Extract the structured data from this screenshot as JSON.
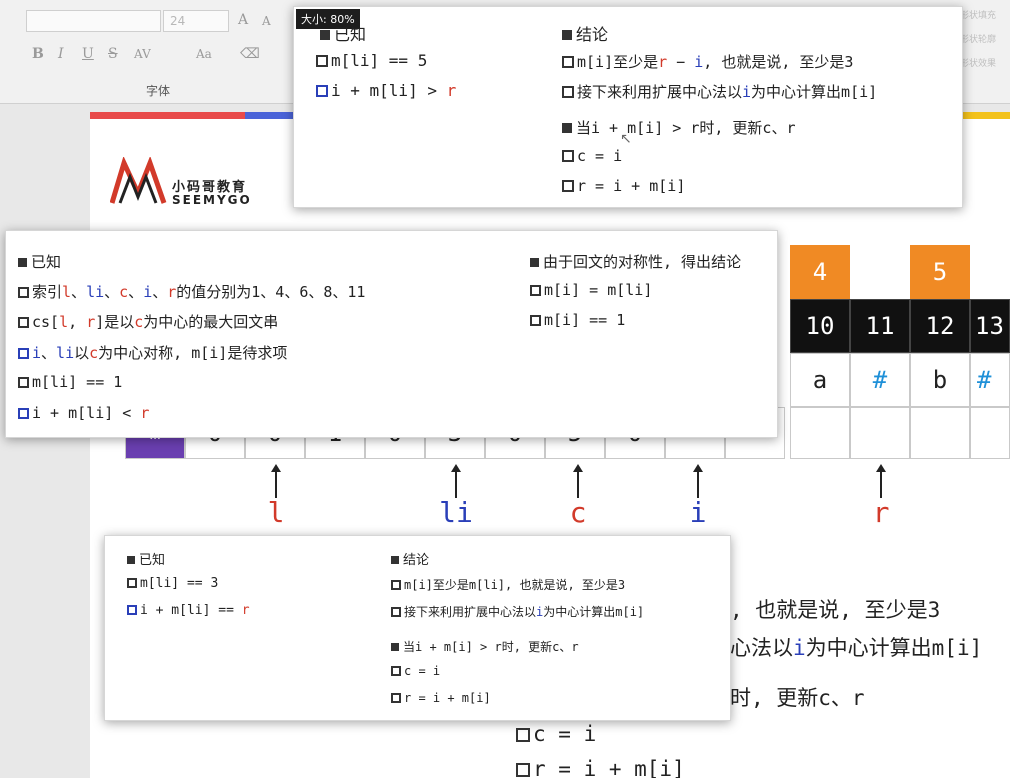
{
  "ribbon": {
    "font_name": "",
    "font_size": "24",
    "group_label": "字体",
    "btn_grow": "A",
    "btn_shrink": "A",
    "bold": "B",
    "italic": "I",
    "underline": "U",
    "strike": "S",
    "spacing": "AV",
    "case": "Aa",
    "right_labels": [
      "形状填充",
      "形状轮廓",
      "形状效果"
    ]
  },
  "logo": {
    "cn": "小码哥教育",
    "en": "SEEMYGO"
  },
  "tooltip": "大小: 80%",
  "table": {
    "top_numbers": [
      {
        "index": 0,
        "text": "4"
      },
      {
        "index": 2,
        "text": "5"
      }
    ],
    "indices": [
      "10",
      "11",
      "12",
      "13"
    ],
    "chars": [
      "a",
      "#",
      "b",
      "#"
    ],
    "row_m_first": "m",
    "row_m_values": [
      "0",
      "0",
      "1",
      "0",
      "3",
      "0",
      "5",
      "0"
    ]
  },
  "pointers": [
    {
      "label": "l",
      "color": "#d23a2a"
    },
    {
      "label": "li",
      "color": "#2a3fb8"
    },
    {
      "label": "c",
      "color": "#d23a2a"
    },
    {
      "label": "i",
      "color": "#2a3fb8"
    },
    {
      "label": "r",
      "color": "#d23a2a"
    }
  ],
  "background_lines": [
    ", 也就是说, 至少是3",
    "心法以",
    "i",
    "为中心计算出m[i]",
    "时, 更新c、r",
    "c = i",
    "r = i + m[i]"
  ],
  "card_top": {
    "known_title": "已知",
    "known_1": "m[li] == 5",
    "known_2_pre": "i + m[li] > ",
    "known_2_r": "r",
    "concl_title": "结论",
    "concl_1_a": "m[i]至少是",
    "concl_1_r": "r",
    "concl_1_b": " − ",
    "concl_1_i": "i",
    "concl_1_c": ", 也就是说, 至少是3",
    "concl_2": "接下来利用扩展中心法以",
    "concl_2_i": "i",
    "concl_2_b": "为中心计算出m[i]",
    "concl_3": "当i + m[i] > r时, 更新c、r",
    "concl_4": "c = i",
    "concl_5": "r = i + m[i]"
  },
  "card_mid": {
    "known_title": "已知",
    "k1_a": "索引",
    "k1_l": "l",
    "k1_s1": "、",
    "k1_li": "li",
    "k1_s2": "、",
    "k1_c": "c",
    "k1_s3": "、",
    "k1_i": "i",
    "k1_s4": "、",
    "k1_r": "r",
    "k1_b": "的值分别为1、4、6、8、11",
    "k2_a": "cs[",
    "k2_l": "l",
    "k2_b": ", ",
    "k2_r": "r",
    "k2_c": "]是以",
    "k2_cc": "c",
    "k2_d": "为中心的最大回文串",
    "k3_i": "i",
    "k3_a": "、",
    "k3_li": "li",
    "k3_b": "以",
    "k3_c": "c",
    "k3_d": "为中心对称, m[i]是待求项",
    "k4": "m[li] == 1",
    "k5_a": "i + m[li] < ",
    "k5_r": "r",
    "concl_title": "由于回文的对称性, 得出结论",
    "c1": "m[i] = m[li]",
    "c2": "m[i] == 1"
  },
  "card_bottom": {
    "known_title": "已知",
    "known_1": "m[li] == 3",
    "known_2_pre": "i + m[li] == ",
    "known_2_r": "r",
    "concl_title": "结论",
    "c1": "m[i]至少是m[li], 也就是说, 至少是3",
    "c2_a": "接下来利用扩展中心法以",
    "c2_i": "i",
    "c2_b": "为中心计算出m[i]",
    "c3": "当i + m[i] > r时, 更新c、r",
    "c4": "c = i",
    "c5": "r = i + m[i]"
  },
  "colors": {
    "orange": "#f08a24",
    "purple": "#6a3fb0",
    "red": "#d23a2a",
    "blue": "#2a3fb8",
    "hash_blue": "#1e90d8",
    "stripe_red": "#e84a4a",
    "stripe_blue": "#4a63d8",
    "stripe_yellow": "#f3c21b"
  }
}
